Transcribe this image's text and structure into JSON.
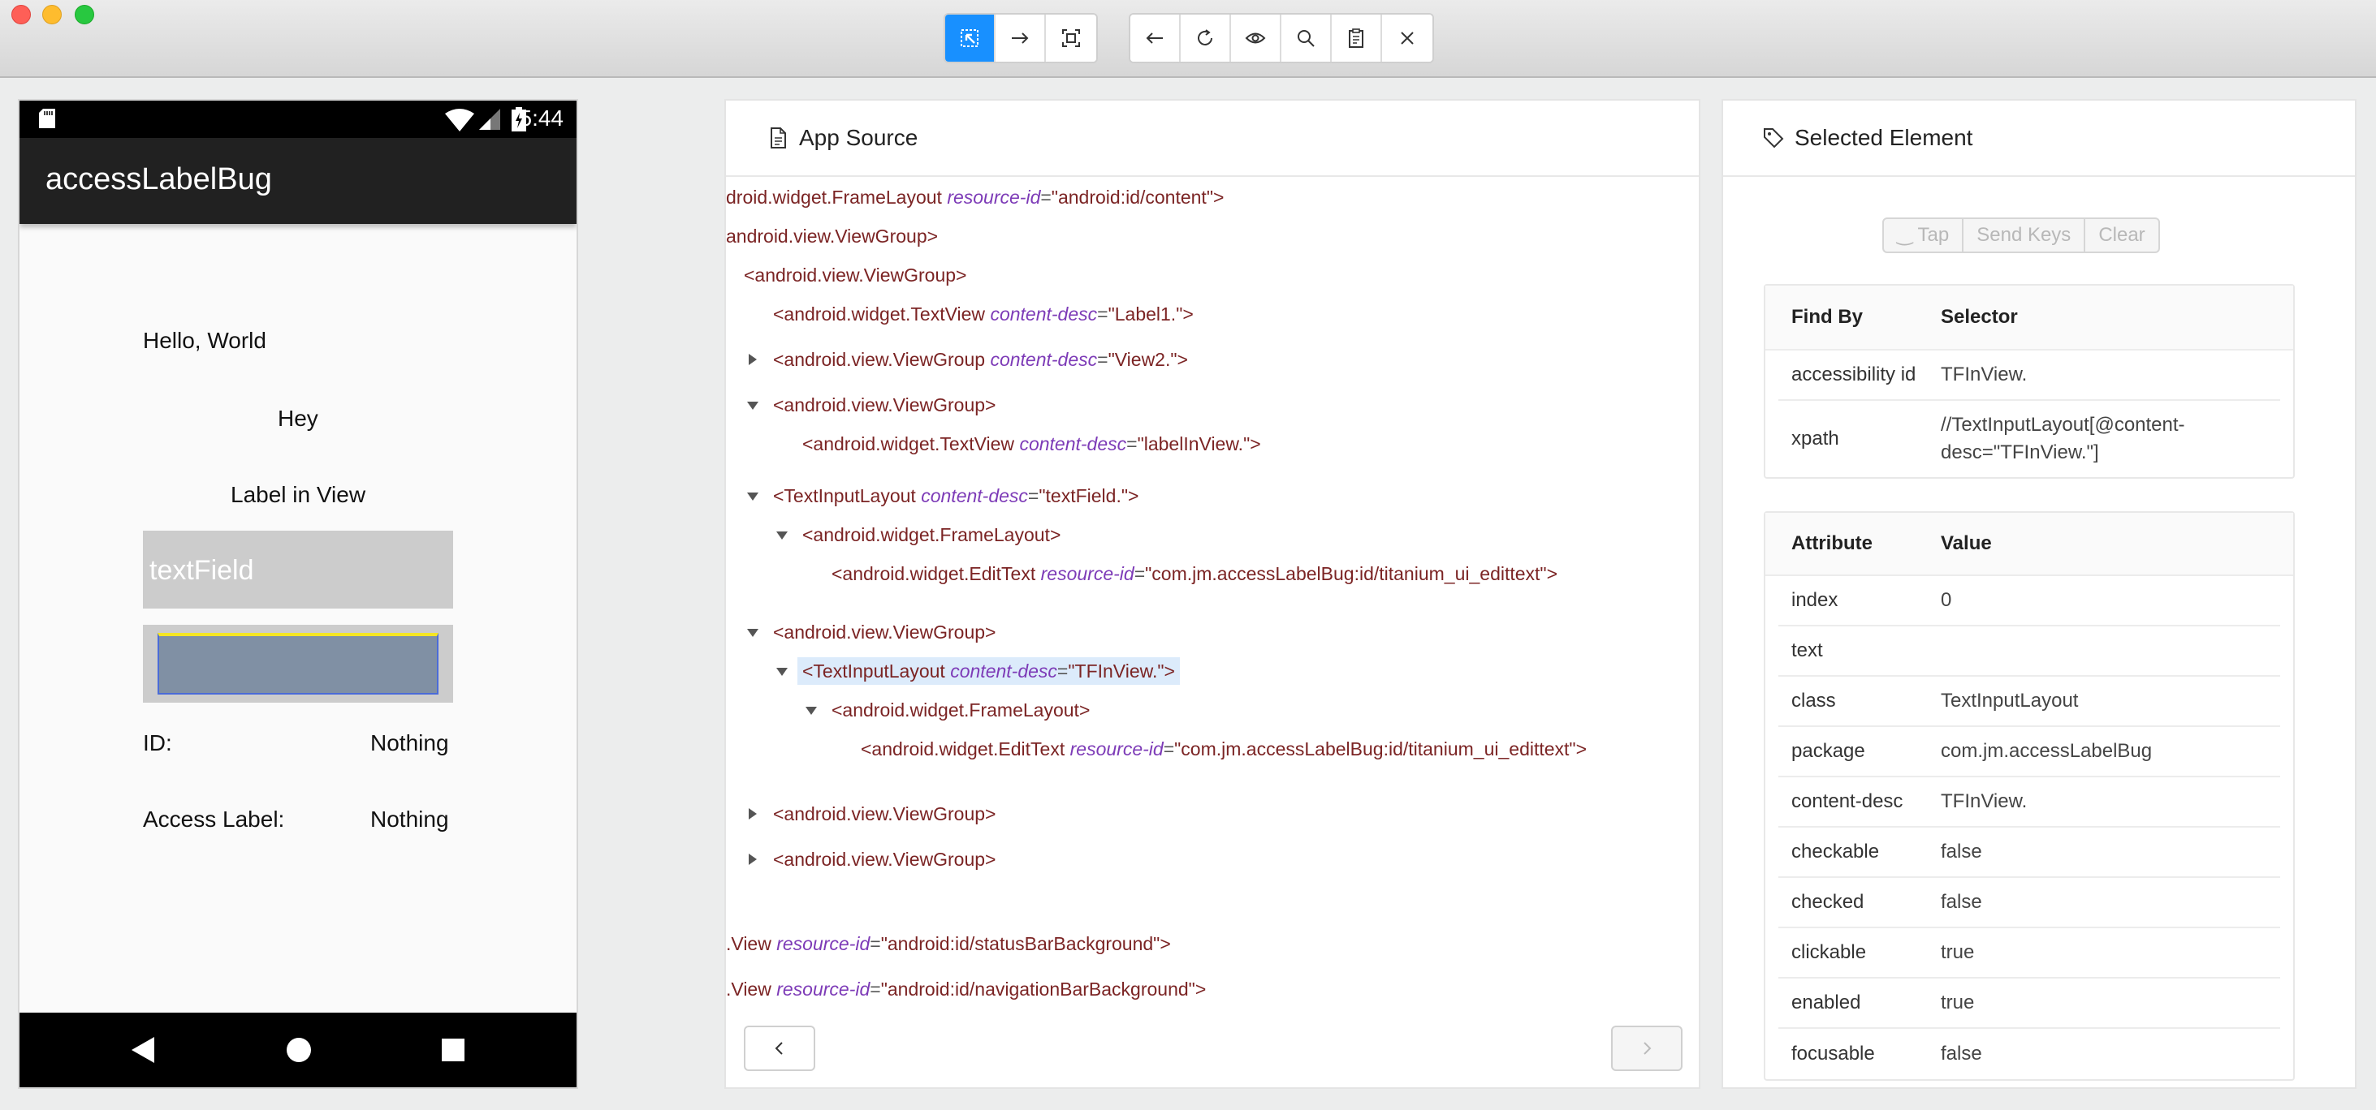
{
  "toolbar": {
    "mode_buttons": [
      {
        "icon": "select-element-icon",
        "active": true
      },
      {
        "icon": "swipe-arrow-icon",
        "active": false
      },
      {
        "icon": "tap-coordinates-icon",
        "active": false
      }
    ],
    "action_buttons": [
      {
        "icon": "back-arrow-icon"
      },
      {
        "icon": "refresh-icon"
      },
      {
        "icon": "eye-icon"
      },
      {
        "icon": "search-icon"
      },
      {
        "icon": "clipboard-icon"
      },
      {
        "icon": "close-icon"
      }
    ]
  },
  "device": {
    "time": "5:44",
    "app_title": "accessLabelBug",
    "hello": "Hello, World",
    "hey": "Hey",
    "label_in_view": "Label in View",
    "textfield_hint": "textField",
    "id_label": "ID:",
    "id_value": "Nothing",
    "access_label": "Access Label:",
    "access_value": "Nothing"
  },
  "source": {
    "title": "App Source",
    "nodes": [
      {
        "caret": "",
        "tag": "droid.widget.FrameLayout",
        "attr": "resource-id",
        "val": "\"android:id/content\"",
        "close": ">"
      },
      {
        "caret": "",
        "tag": "android.view.ViewGroup",
        "attr": "",
        "val": "",
        "close": ">"
      },
      {
        "caret": "",
        "tag": "<android.view.ViewGroup",
        "attr": "",
        "val": "",
        "close": ">"
      },
      {
        "caret": "",
        "tag": "<android.widget.TextView",
        "attr": "content-desc",
        "val": "\"Label1.\"",
        "close": ">"
      },
      {
        "caret": "right",
        "tag": "<android.view.ViewGroup",
        "attr": "content-desc",
        "val": "\"View2.\"",
        "close": ">"
      },
      {
        "caret": "down",
        "tag": "<android.view.ViewGroup",
        "attr": "",
        "val": "",
        "close": ">"
      },
      {
        "caret": "",
        "tag": "<android.widget.TextView",
        "attr": "content-desc",
        "val": "\"labelInView.\"",
        "close": ">"
      },
      {
        "caret": "down",
        "tag": "<TextInputLayout",
        "attr": "content-desc",
        "val": "\"textField.\"",
        "close": ">"
      },
      {
        "caret": "down",
        "tag": "<android.widget.FrameLayout",
        "attr": "",
        "val": "",
        "close": ">"
      },
      {
        "caret": "",
        "tag": "<android.widget.EditText",
        "attr": "resource-id",
        "val": "\"com.jm.accessLabelBug:id/titanium_ui_edittext\"",
        "close": ">"
      },
      {
        "caret": "down",
        "tag": "<android.view.ViewGroup",
        "attr": "",
        "val": "",
        "close": ">"
      },
      {
        "caret": "down",
        "tag": "<TextInputLayout",
        "attr": "content-desc",
        "val": "\"TFInView.\"",
        "close": ">"
      },
      {
        "caret": "down",
        "tag": "<android.widget.FrameLayout",
        "attr": "",
        "val": "",
        "close": ">"
      },
      {
        "caret": "",
        "tag": "<android.widget.EditText",
        "attr": "resource-id",
        "val": "\"com.jm.accessLabelBug:id/titanium_ui_edittext\"",
        "close": ">"
      },
      {
        "caret": "right",
        "tag": "<android.view.ViewGroup",
        "attr": "",
        "val": "",
        "close": ">"
      },
      {
        "caret": "right",
        "tag": "<android.view.ViewGroup",
        "attr": "",
        "val": "",
        "close": ">"
      },
      {
        "caret": "",
        "tag": ".View",
        "attr": "resource-id",
        "val": "\"android:id/statusBarBackground\"",
        "close": ">"
      },
      {
        "caret": "",
        "tag": ".View",
        "attr": "resource-id",
        "val": "\"android:id/navigationBarBackground\"",
        "close": ">"
      }
    ]
  },
  "selected": {
    "title": "Selected Element",
    "actions": [
      "Tap",
      "Send Keys",
      "Clear"
    ],
    "findby": {
      "col1": "Find By",
      "col2": "Selector",
      "rows": [
        {
          "k": "accessibility id",
          "v": "TFInView."
        },
        {
          "k": "xpath",
          "v": "//TextInputLayout[@content-desc=\"TFInView.\"]"
        }
      ]
    },
    "attributes": {
      "col1": "Attribute",
      "col2": "Value",
      "rows": [
        {
          "k": "index",
          "v": "0"
        },
        {
          "k": "text",
          "v": ""
        },
        {
          "k": "class",
          "v": "TextInputLayout"
        },
        {
          "k": "package",
          "v": "com.jm.accessLabelBug"
        },
        {
          "k": "content-desc",
          "v": "TFInView."
        },
        {
          "k": "checkable",
          "v": "false"
        },
        {
          "k": "checked",
          "v": "false"
        },
        {
          "k": "clickable",
          "v": "true"
        },
        {
          "k": "enabled",
          "v": "true"
        },
        {
          "k": "focusable",
          "v": "false"
        }
      ]
    }
  }
}
